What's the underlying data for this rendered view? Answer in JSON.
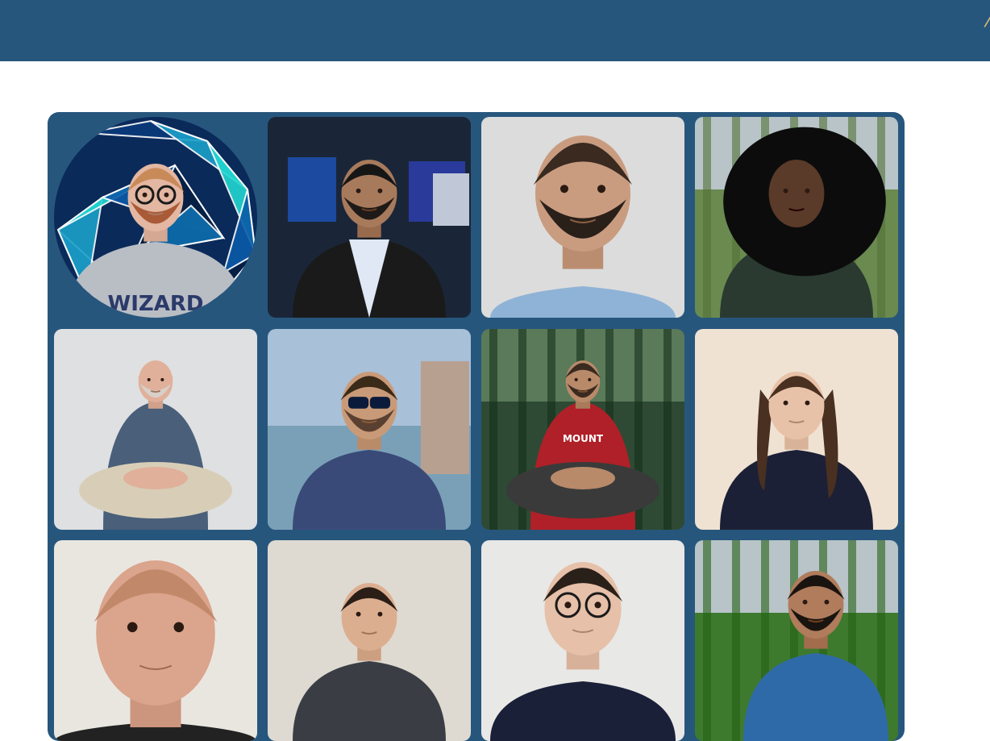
{
  "header": {
    "edge_glyph": "⁄",
    "background_color": "#27567d"
  },
  "team": {
    "panel_color": "#27567d",
    "members": [
      {
        "name": "member-photo-1",
        "style": "round-geodesic",
        "skin": "#e3b7a2",
        "hair": "#c98a5a",
        "beard": "#a95a36",
        "shirt": "#b9bdc4",
        "bg": "#0a2a5a",
        "shirt_text": "WIZARD"
      },
      {
        "name": "member-photo-2",
        "style": "studio",
        "skin": "#a87a5c",
        "hair": "#161616",
        "beard": "#1e1a18",
        "shirt": "#1a1a1a",
        "bg": "#1a2638"
      },
      {
        "name": "member-photo-3",
        "style": "passport",
        "skin": "#c99c80",
        "hair": "#3a2a20",
        "beard": "#2a201a",
        "shirt": "#8fb3d6",
        "bg": "#dcdcdc"
      },
      {
        "name": "member-photo-4",
        "style": "outdoor",
        "skin": "#5a3a28",
        "hair": "#0c0c0c",
        "beard": "",
        "shirt": "#2a3a30",
        "bg": "#6a8a50"
      },
      {
        "name": "member-photo-5",
        "style": "seated",
        "skin": "#e0b09a",
        "hair": "#e0b09a",
        "beard": "#d8d0c8",
        "shirt": "#4a5f7a",
        "bg": "#dfe0e2"
      },
      {
        "name": "member-photo-6",
        "style": "sunglasses",
        "skin": "#c99a78",
        "hair": "#3a2a18",
        "beard": "#5a4030",
        "shirt": "#3a4a78",
        "bg": "#a8c0d8"
      },
      {
        "name": "member-photo-7",
        "style": "forest",
        "skin": "#b88a6a",
        "hair": "#3a2a20",
        "beard": "#3a2a20",
        "shirt": "#b02028",
        "bg": "#2e4a34",
        "shirt_text": "MOUNT"
      },
      {
        "name": "member-photo-8",
        "style": "plain",
        "skin": "#e8c2a8",
        "hair": "#4a3020",
        "beard": "",
        "shirt": "#1c2036",
        "bg": "#efe2d2"
      },
      {
        "name": "member-photo-9",
        "style": "closeup",
        "skin": "#dba48c",
        "hair": "#c2886a",
        "beard": "",
        "shirt": "#222222",
        "bg": "#e9e6e0"
      },
      {
        "name": "member-photo-10",
        "style": "plain",
        "skin": "#dcae90",
        "hair": "#2a1e16",
        "beard": "",
        "shirt": "#3a3e44",
        "bg": "#dedad2"
      },
      {
        "name": "member-photo-11",
        "style": "glasses",
        "skin": "#e6c0a8",
        "hair": "#2a201a",
        "beard": "",
        "shirt": "#1a2038",
        "bg": "#e8e8e6"
      },
      {
        "name": "member-photo-12",
        "style": "garden",
        "skin": "#b07c5c",
        "hair": "#1a1410",
        "beard": "#1a1410",
        "shirt": "#2f6aa8",
        "bg": "#3e7a2e"
      }
    ]
  }
}
